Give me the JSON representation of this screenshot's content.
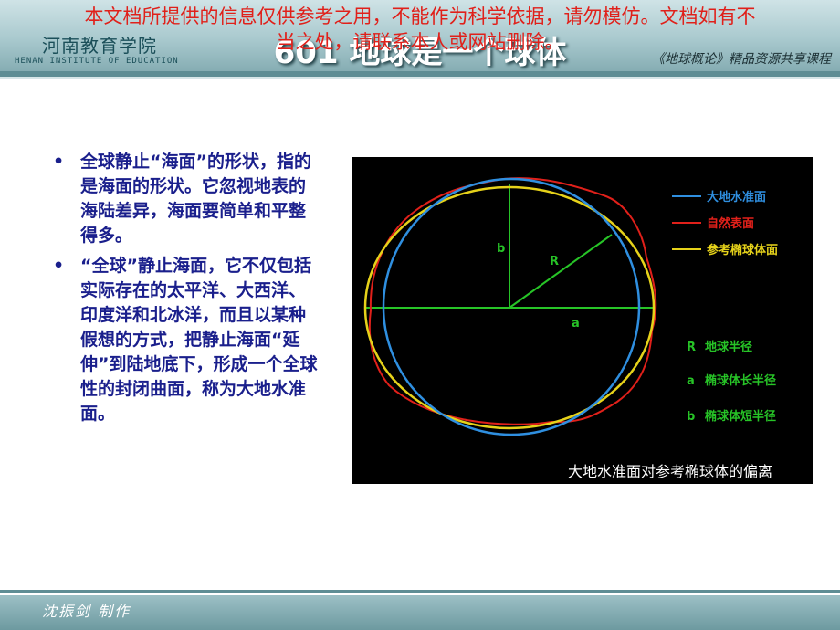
{
  "header": {
    "school": "河南教育学院",
    "school_en": "HENAN INSTITUTE OF EDUCATION",
    "title": "601 地球是一个球体",
    "course": "《地球概论》精品资源共享课程"
  },
  "watermark": {
    "line1": "本文档所提供的信息仅供参考之用，不能作为科学依据，请勿模仿。文档如有不",
    "line2": "当之处，请联系本人或网站删除。"
  },
  "bullets": [
    "全球静止“海面”的形状，指的是海面的形状。它忽视地表的海陆差异，海面要简单和平整得多。",
    "“全球”静止海面，它不仅包括实际存在的太平洋、大西洋、印度洋和北冰洋，而且以某种假想的方式，把静止海面“延伸”到陆地底下，形成一个全球性的封闭曲面，称为大地水准面。"
  ],
  "bullet_symbol": "•",
  "figure": {
    "legend": [
      {
        "label": "大地水准面",
        "color": "#2f8fe0"
      },
      {
        "label": "自然表面",
        "color": "#e0201a"
      },
      {
        "label": "参考椭球体面",
        "color": "#e6d21a"
      }
    ],
    "symbols": [
      {
        "symbol": "R",
        "label": "地球半径"
      },
      {
        "symbol": "a",
        "label": "椭球体长半径"
      },
      {
        "symbol": "b",
        "label": "椭球体短半径"
      }
    ],
    "diagram_labels": {
      "b": "b",
      "R": "R",
      "a": "a"
    },
    "caption": "大地水准面对参考椭球体的偏离",
    "axis_color": "#27c427"
  },
  "footer": {
    "author": "沈振剑 制作"
  }
}
